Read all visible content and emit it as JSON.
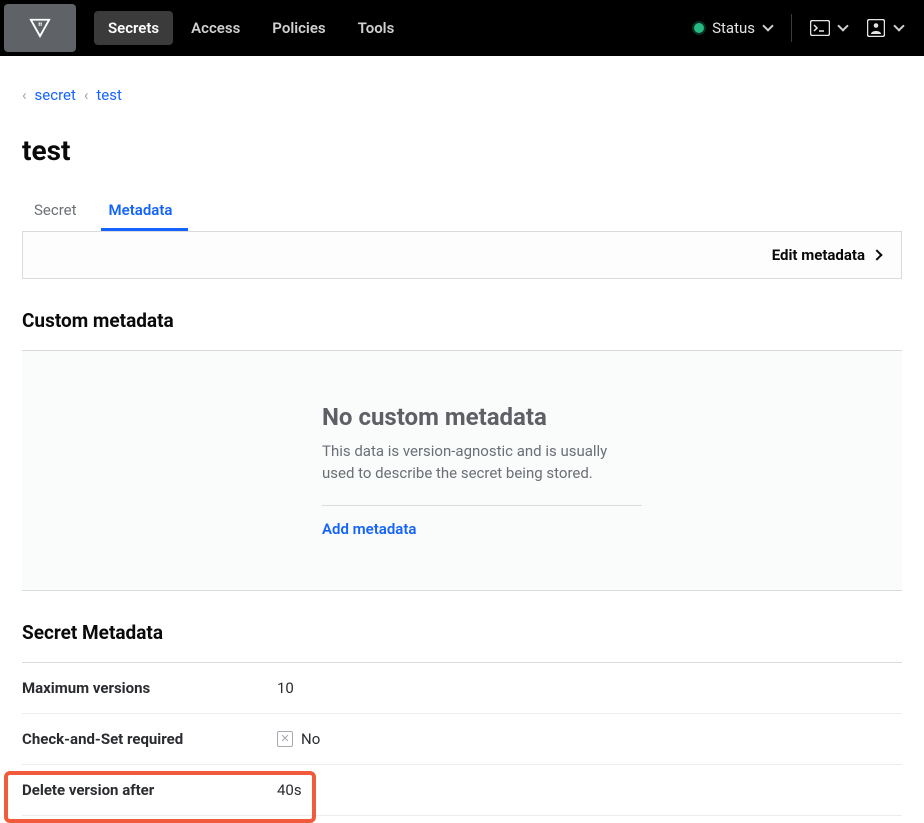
{
  "nav": {
    "items": [
      {
        "label": "Secrets",
        "active": true
      },
      {
        "label": "Access",
        "active": false
      },
      {
        "label": "Policies",
        "active": false
      },
      {
        "label": "Tools",
        "active": false
      }
    ],
    "status_label": "Status"
  },
  "breadcrumbs": [
    {
      "label": "secret"
    },
    {
      "label": "test"
    }
  ],
  "page_title": "test",
  "tabs": [
    {
      "label": "Secret",
      "active": false
    },
    {
      "label": "Metadata",
      "active": true
    }
  ],
  "edit_metadata_label": "Edit metadata",
  "custom_metadata": {
    "section_title": "Custom metadata",
    "empty_title": "No custom metadata",
    "empty_desc": "This data is version-agnostic and is usually used to describe the secret being stored.",
    "add_link": "Add metadata"
  },
  "secret_metadata": {
    "section_title": "Secret Metadata",
    "rows": [
      {
        "label": "Maximum versions",
        "value": "10",
        "icon": null
      },
      {
        "label": "Check-and-Set required",
        "value": "No",
        "icon": "x"
      },
      {
        "label": "Delete version after",
        "value": "40s",
        "icon": null
      }
    ]
  }
}
